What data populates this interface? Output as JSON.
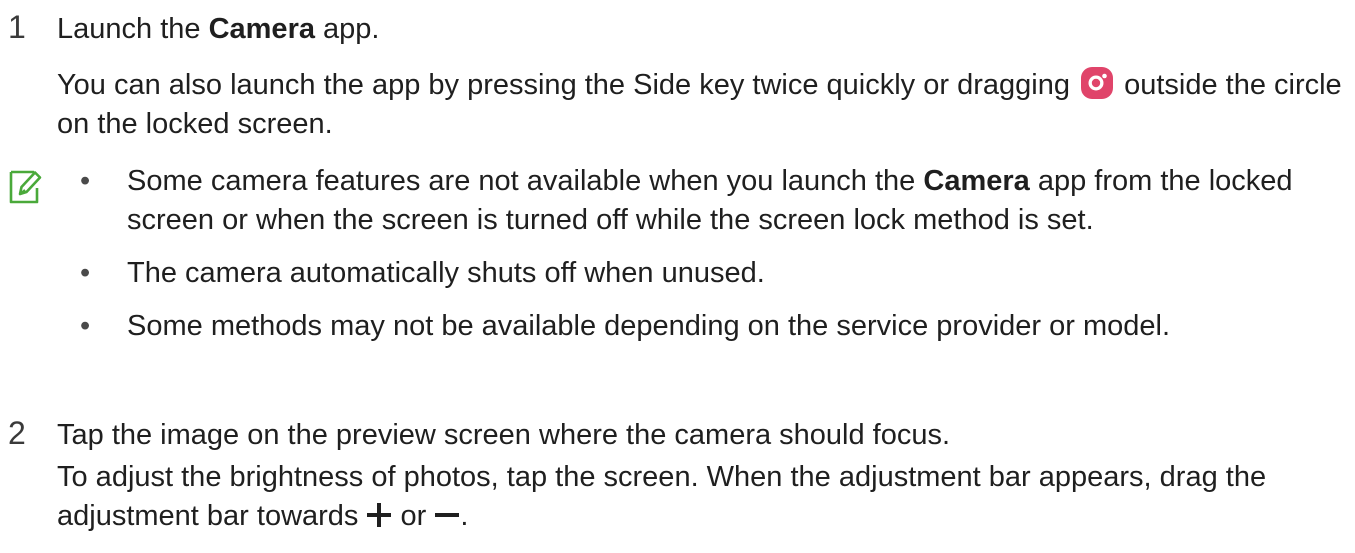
{
  "steps": [
    {
      "number": "1",
      "text_before": "Launch the ",
      "bold": "Camera",
      "text_after": " app.",
      "detail_before": "You can also launch the app by pressing the Side key twice quickly or dragging ",
      "detail_icon": "camera-app-icon",
      "detail_after": " outside the circle on the locked screen."
    },
    {
      "number": "2",
      "text": "Tap the image on the preview screen where the camera should focus.",
      "detail_before": "To adjust the brightness of photos, tap the screen. When the adjustment bar appears, drag the adjustment bar towards ",
      "plus_icon": "plus-icon",
      "detail_mid": " or ",
      "minus_icon": "minus-icon",
      "detail_after": "."
    }
  ],
  "note": {
    "icon": "note-icon",
    "bullet_char": "•",
    "items": [
      {
        "before": "Some camera features are not available when you launch the ",
        "bold": "Camera",
        "after": " app from the locked screen or when the screen is turned off while the screen lock method is set."
      },
      {
        "text": "The camera automatically shuts off when unused."
      },
      {
        "text": "Some methods may not be available depending on the service provider or model."
      }
    ]
  },
  "colors": {
    "note_icon": "#4aa93a",
    "camera_icon_bg": "#e0446a",
    "text": "#1f1f1f"
  }
}
